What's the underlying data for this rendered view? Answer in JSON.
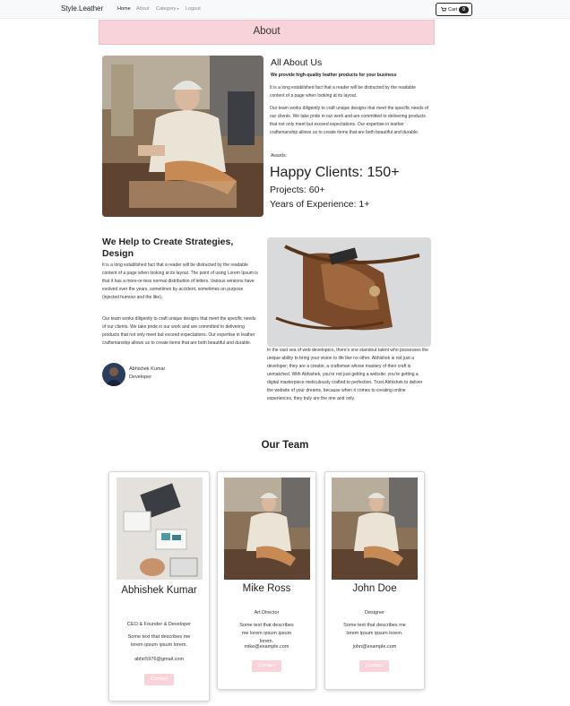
{
  "navbar": {
    "brand": "Style.Leather",
    "links": [
      "Home",
      "About",
      "Category",
      "Logout"
    ],
    "cart_label": "Cart",
    "cart_count": "0"
  },
  "about_banner": {
    "title": "About"
  },
  "about": {
    "heading": "All About Us",
    "tagline": "We provide high-quality leather products for your business",
    "para1": "It is a long established fact that a reader will be distracted by the readable content of a page when looking at its layout.",
    "para2": "Our team works diligently to craft unique designs that meet the specific needs of our clients. We take pride in our work and are committed to delivering products that not only meet but exceed expectations. Our expertise in leather craftsmanship allows us to create items that are both beautiful and durable.",
    "awards_label": "Awards:",
    "clients": "Happy Clients: 150+",
    "projects": "Projects: 60+",
    "experience": "Years of Experience: 1+"
  },
  "strategies": {
    "heading": "We Help to Create Strategies, Design",
    "para1": "It is a long established fact that a reader will be distracted by the readable content of a page when looking at its layout. The point of using Lorem Ipsum is that it has a more-or-less normal distribution of letters. Various versions have evolved over the years, sometimes by accident, sometimes on purpose (injected humour and the like).",
    "para2": "Our team works diligently to craft unique designs that meet the specific needs of our clients. We take pride in our work and are committed to delivering products that not only meet but exceed expectations. Our expertise in leather craftsmanship allows us to create items that are both beautiful and durable.",
    "author_name": "Abhishek Kumar",
    "author_role": "Developer",
    "side_para": "In the vast sea of web developers, there's one standout talent who possesses the unique ability to bring your vision to life like no other. Abhishek is not just a developer; they are a creator, a craftsman whose mastery of their craft is unmatched. With Abhishek, you're not just getting a website; you're getting a digital masterpiece meticulously crafted to perfection. Trust Abhishek to deliver the website of your dreams, because when it comes to creating online experiences, they truly are the one and only."
  },
  "team": {
    "title": "Our Team",
    "members": [
      {
        "name": "Abhishek Kumar",
        "role": "CEO & Founder & Developer",
        "desc": "Some text that describes me lorem ipsum ipsum lorem.",
        "email": "abhir5976@gmail.com",
        "button": "Contact"
      },
      {
        "name": "Mike Ross",
        "role": "Art Director",
        "desc": "Some text that describes me lorem ipsum ipsum lorem.",
        "email": "mike@example.com",
        "button": "Contact"
      },
      {
        "name": "John Doe",
        "role": "Designer",
        "desc": "Some text that describes me lorem ipsum ipsum lorem.",
        "email": "john@example.com",
        "button": "Contact"
      }
    ]
  },
  "colors": {
    "banner_pink": "#f8d3da",
    "navbar_bg": "#f8f9fa",
    "text_dark": "#222222"
  },
  "icons": {
    "cart": "cart-icon",
    "category_dropdown": "chevron-down-icon"
  }
}
